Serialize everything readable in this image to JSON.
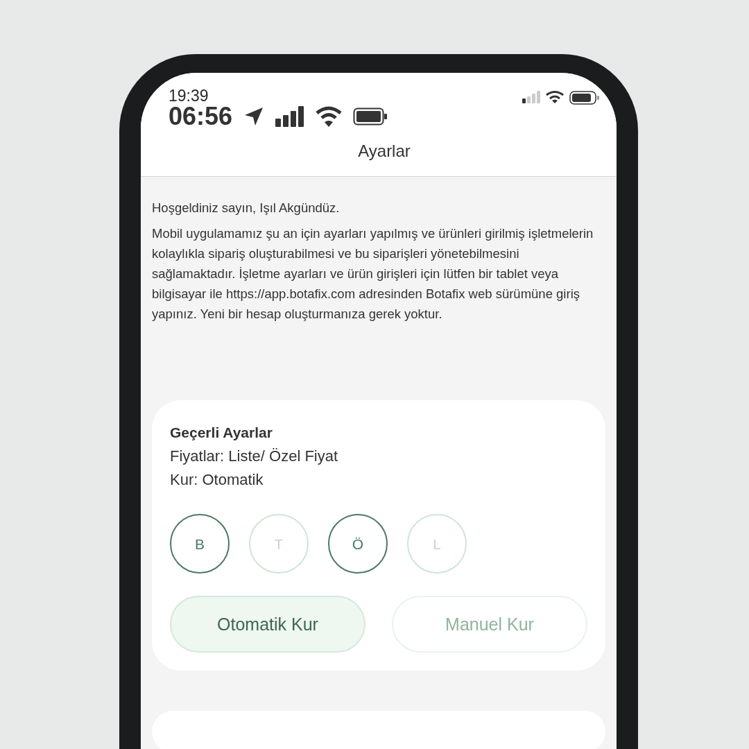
{
  "status_bar": {
    "time_small": "19:39",
    "time_large": "06:56"
  },
  "header": {
    "title": "Ayarlar"
  },
  "intro": {
    "greeting": "Hoşgeldiniz sayın, Işıl Akgündüz.",
    "paragraph": "Mobil uygulamamız şu an için ayarları yapılmış ve ürünleri girilmiş işletmelerin kolaylıkla sipariş oluşturabilmesi ve bu siparişleri yönetebilmesini sağlamaktadır. İşletme ayarları ve ürün girişleri için lütfen bir tablet veya bilgisayar ile https://app.botafix.com adresinden Botafix web sürümüne giriş yapınız. Yeni bir hesap oluşturmanıza gerek yoktur."
  },
  "settings_card": {
    "title": "Geçerli Ayarlar",
    "lines": [
      "Fiyatlar: Liste/ Özel Fiyat",
      "Kur: Otomatik"
    ],
    "options": [
      {
        "label": "B",
        "selected": true
      },
      {
        "label": "T",
        "selected": false
      },
      {
        "label": "Ö",
        "selected": true
      },
      {
        "label": "L",
        "selected": false
      }
    ],
    "buttons": [
      {
        "label": "Otomatik Kur",
        "selected": true
      },
      {
        "label": "Manuel Kur",
        "selected": false
      }
    ]
  }
}
